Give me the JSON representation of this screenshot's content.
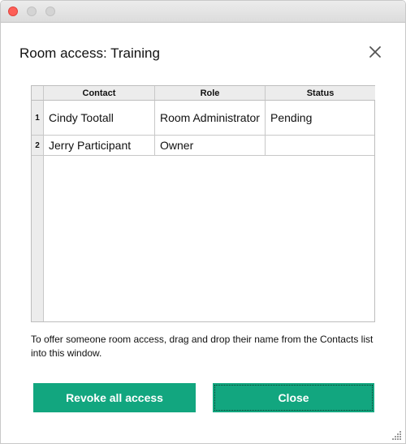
{
  "window": {
    "title": "Room access: Training"
  },
  "table": {
    "headers": [
      "Contact",
      "Role",
      "Status"
    ],
    "rows": [
      {
        "num": "1",
        "contact": "Cindy Tootall",
        "role": "Room Administrator",
        "status": "Pending"
      },
      {
        "num": "2",
        "contact": "Jerry Participant",
        "role": "Owner",
        "status": ""
      }
    ]
  },
  "hint": "To offer someone room access, drag and drop their name from the Contacts list into this window.",
  "buttons": {
    "revoke": "Revoke all access",
    "close": "Close"
  },
  "colors": {
    "button_bg": "#12a67f",
    "close_traffic": "#fd5f57"
  },
  "icons": {
    "close": "close-icon",
    "resize": "resize-grip-icon"
  }
}
